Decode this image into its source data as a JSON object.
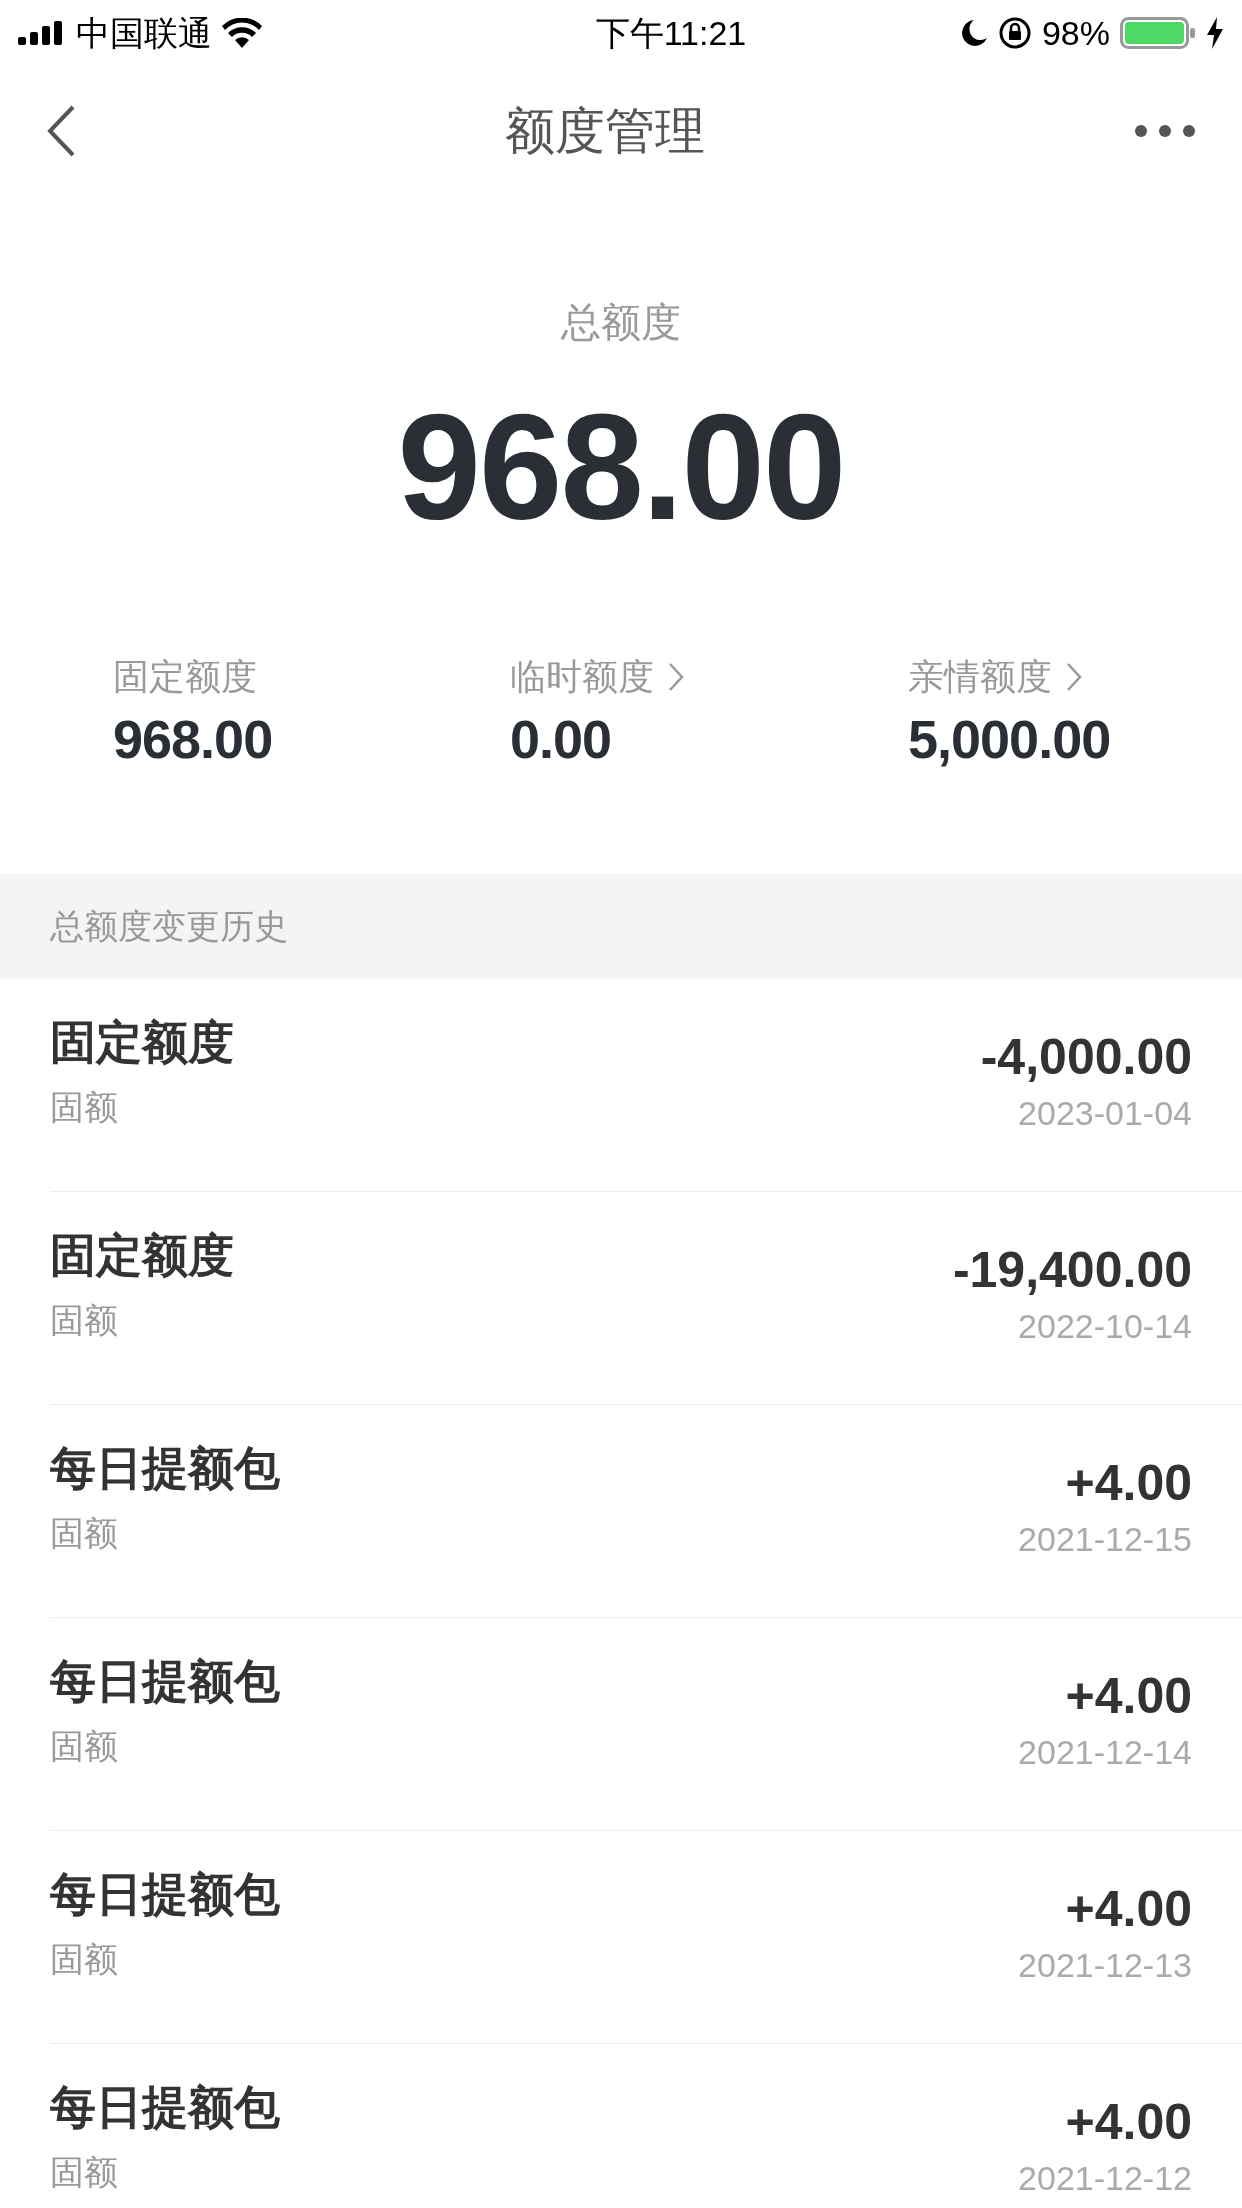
{
  "status_bar": {
    "carrier": "中国联通",
    "time": "下午11:21",
    "battery": "98%"
  },
  "nav": {
    "title": "额度管理"
  },
  "total": {
    "label": "总额度",
    "amount": "968.00"
  },
  "stats": [
    {
      "label": "固定额度",
      "value": "968.00",
      "has_arrow": false
    },
    {
      "label": "临时额度",
      "value": "0.00",
      "has_arrow": true
    },
    {
      "label": "亲情额度",
      "value": "5,000.00",
      "has_arrow": true
    }
  ],
  "history": {
    "title": "总额度变更历史",
    "rows": [
      {
        "name": "固定额度",
        "type": "固额",
        "amount": "-4,000.00",
        "date": "2023-01-04"
      },
      {
        "name": "固定额度",
        "type": "固额",
        "amount": "-19,400.00",
        "date": "2022-10-14"
      },
      {
        "name": "每日提额包",
        "type": "固额",
        "amount": "+4.00",
        "date": "2021-12-15"
      },
      {
        "name": "每日提额包",
        "type": "固额",
        "amount": "+4.00",
        "date": "2021-12-14"
      },
      {
        "name": "每日提额包",
        "type": "固额",
        "amount": "+4.00",
        "date": "2021-12-13"
      },
      {
        "name": "每日提额包",
        "type": "固额",
        "amount": "+4.00",
        "date": "2021-12-12"
      }
    ]
  }
}
